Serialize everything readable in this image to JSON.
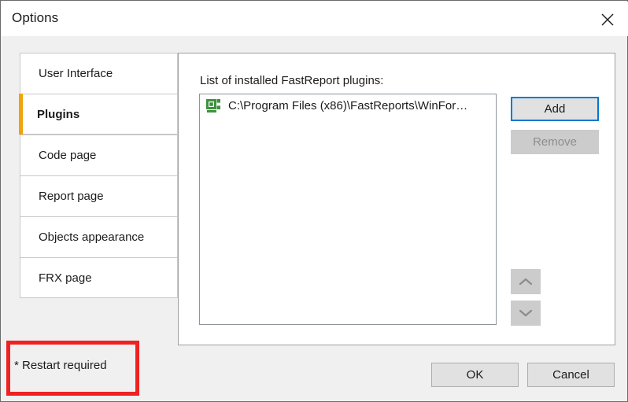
{
  "window": {
    "title": "Options",
    "close_icon": "close-icon"
  },
  "sidebar": {
    "tabs": [
      {
        "label": "User Interface",
        "selected": false
      },
      {
        "label": "Plugins",
        "selected": true
      },
      {
        "label": "Code page",
        "selected": false
      },
      {
        "label": "Report page",
        "selected": false
      },
      {
        "label": "Objects appearance",
        "selected": false
      },
      {
        "label": "FRX page",
        "selected": false
      }
    ],
    "accent_color": "#f0a30a"
  },
  "content": {
    "list_caption": "List of installed FastReport plugins:",
    "plugins": [
      {
        "icon": "plugin-icon",
        "path": "C:\\Program Files (x86)\\FastReports\\WinFor…"
      }
    ],
    "buttons": {
      "add_label": "Add",
      "remove_label": "Remove",
      "move_up_icon": "chevron-up-icon",
      "move_down_icon": "chevron-down-icon",
      "add_focus_color": "#0078d7",
      "remove_enabled": false
    }
  },
  "footer": {
    "restart_note": "* Restart required",
    "highlight_color": "#ee2222",
    "ok_label": "OK",
    "cancel_label": "Cancel"
  }
}
